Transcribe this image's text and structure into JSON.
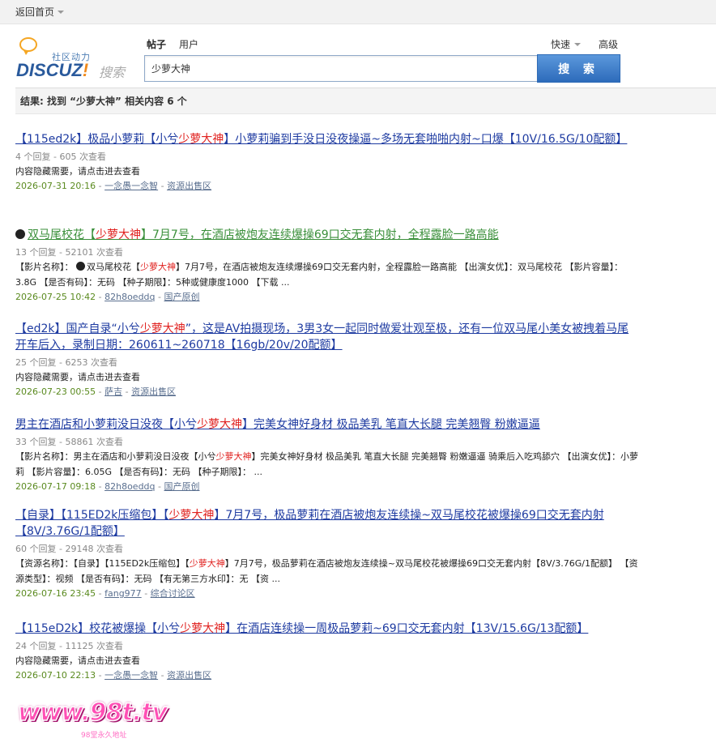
{
  "topbar": {
    "home_label": "返回首页"
  },
  "logo": {
    "community": "社区动力",
    "brand_main": "DISCUZ",
    "brand_ex": "!",
    "search_word": "搜索"
  },
  "tabs": [
    {
      "label": "帖子"
    },
    {
      "label": "用户"
    }
  ],
  "right_links": {
    "quick": "快速",
    "advanced": "高级"
  },
  "search": {
    "value": "少萝大神",
    "button": "搜 索"
  },
  "summary": "结果: 找到 “少萝大神” 相关内容 6 个",
  "results": [
    {
      "title_parts": [
        "【115ed2k】极品小萝莉【小兮",
        "少萝大神",
        "】小萝莉骗到手没日没夜操逼~多场无套啪啪内射~口爆【10V/16.5G/10配额】"
      ],
      "meta": "4 个回复 - 605 次查看",
      "desc_parts": [
        "内容隐藏需要，请点击进去查看"
      ],
      "date": "2026-07-31 20:16",
      "author": "一念愚一念智",
      "forum": "资源出售区"
    },
    {
      "title_parts": [
        "双马尾校花【",
        "少萝大神",
        "】7月7号，在酒店被炮友连续爆操69口交无套内射，全程露脸一路高能"
      ],
      "meta": "13 个回复 - 52101 次查看",
      "desc_parts": [
        "【影片名称】：",
        "双马尾校花【",
        "少萝大神",
        "】7月7号，在酒店被炮友连续爆操69口交无套内射，全程露脸一路高能 【出演女优】：双马尾校花 【影片容量】：3.8G 【是否有码】：无码 【种子期限】：5种或健康度1000 【下载 ..."
      ],
      "date": "2026-07-25 10:42",
      "author": "82h8oeddq",
      "forum": "国产原创"
    },
    {
      "title_parts": [
        "【ed2k】国产自录“小兮",
        "少萝大神",
        "”，这是AV拍摄现场，3男3女一起同时做爱壮观至极，还有一位双马尾小美女被拽着马尾开车后入，录制日期：260611~260718【16gb/20v/20配额】"
      ],
      "meta": "25 个回复 - 6253 次查看",
      "desc_parts": [
        "内容隐藏需要，请点击进去查看"
      ],
      "date": "2026-07-23 00:55",
      "author": "萨吉",
      "forum": "资源出售区"
    },
    {
      "title_parts": [
        "男主在酒店和小萝莉没日没夜【小兮",
        "少萝大神",
        "】完美女神好身材 极品美乳 笔直大长腿 完美翘臀 粉嫩逼逼"
      ],
      "meta": "33 个回复 - 58861 次查看",
      "desc_parts": [
        "【影片名称】：男主在酒店和小萝莉没日没夜【小兮",
        "少萝大神",
        "】完美女神好身材 极品美乳 笔直大长腿 完美翘臀 粉嫩逼逼 骑乘后入吃鸡舔穴 【出演女优】：小萝莉 【影片容量】：6.05G 【是否有码】：无码 【种子期限】： ..."
      ],
      "date": "2026-07-17 09:18",
      "author": "82h8oeddq",
      "forum": "国产原创"
    },
    {
      "title_parts": [
        "【自录】【115ED2k压缩包】【",
        "少萝大神",
        "】7月7号，极品萝莉在酒店被炮友连续操~双马尾校花被爆操69口交无套内射【8V/3.76G/1配额】"
      ],
      "meta": "60 个回复 - 29148 次查看",
      "desc_parts": [
        "【资源名称】：【自录】【115ED2k压缩包】【",
        "少萝大神",
        "】7月7号，极品萝莉在酒店被炮友连续操~双马尾校花被爆操69口交无套内射【8V/3.76G/1配额】 【资源类型】：视频 【是否有码】：无码 【有无第三方水印】：无 【资 ..."
      ],
      "date": "2026-07-16 23:45",
      "author": "fang977",
      "forum": "综合讨论区"
    },
    {
      "title_parts": [
        "【115eD2k】校花被爆操【小兮",
        "少萝大神",
        "】在酒店连续操一周极品萝莉~69口交无套内射【13V/15.6G/13配额】"
      ],
      "meta": "24 个回复 - 11125 次查看",
      "desc_parts": [
        "内容隐藏需要，请点击进去查看"
      ],
      "date": "2026-07-10 22:13",
      "author": "一念愚一念智",
      "forum": "资源出售区"
    }
  ],
  "watermark": {
    "text": "www.98t.tv",
    "sub": "98堂永久地址"
  },
  "colors": {
    "link": "#1e3ba1",
    "highlight": "#e0211f",
    "visited": "#3a8f3a",
    "date": "#5a8a1f"
  }
}
